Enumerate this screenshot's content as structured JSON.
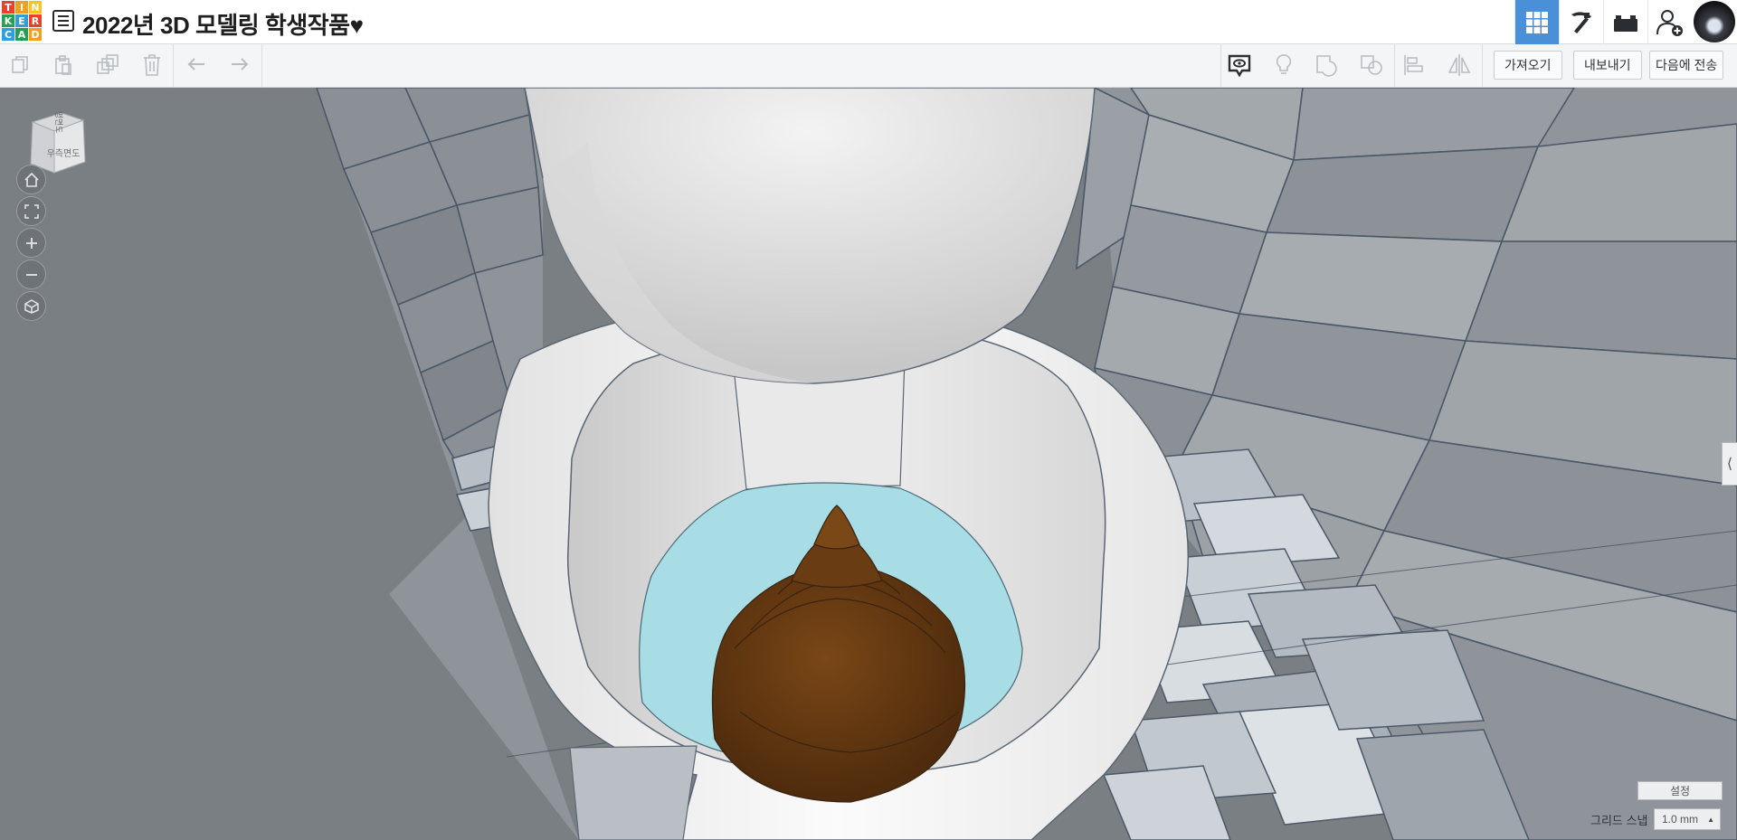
{
  "app": {
    "logo_letters": [
      "T",
      "I",
      "N",
      "K",
      "E",
      "R",
      "C",
      "A",
      "D"
    ],
    "logo_colors": [
      "#e8412c",
      "#f29f1f",
      "#f7c522",
      "#1fa352",
      "#2aa0dc",
      "#e8412c",
      "#2aa0dc",
      "#1fa352",
      "#f29f1f"
    ],
    "project_title": "2022년 3D 모델링 학생작품♥"
  },
  "topbar": {
    "buttons": [
      {
        "name": "3d-design-view-button",
        "icon": "grid-icon",
        "active": true
      },
      {
        "name": "minecraft-view-button",
        "icon": "pickaxe-icon",
        "active": false
      },
      {
        "name": "brick-view-button",
        "icon": "brick-icon",
        "active": false
      },
      {
        "name": "invite-user-button",
        "icon": "add-user-icon",
        "active": false
      }
    ]
  },
  "toolbar": {
    "left_tools": [
      "copy-icon",
      "paste-icon",
      "duplicate-icon",
      "delete-icon",
      "undo-icon",
      "redo-icon"
    ],
    "right_tools": [
      "notes-icon",
      "lightbulb-icon",
      "group-icon",
      "ungroup-icon",
      "align-icon",
      "mirror-icon"
    ],
    "import_label": "가져오기",
    "export_label": "내보내기",
    "send_to_label": "다음에 전송"
  },
  "viewcube": {
    "top_face": "평면도",
    "front_face": "우측면도"
  },
  "nav_buttons": [
    "home-icon",
    "fit-view-icon",
    "zoom-in-icon",
    "zoom-out-icon",
    "perspective-icon"
  ],
  "settings": {
    "settings_label": "설정",
    "grid_snap_label": "그리드 스냅",
    "grid_snap_value": "1.0 mm"
  },
  "colors": {
    "accent": "#4a90d9",
    "poop_brown": "#5e3612",
    "water_blue": "#a8dde6",
    "wall_gray": "#8f959a"
  }
}
